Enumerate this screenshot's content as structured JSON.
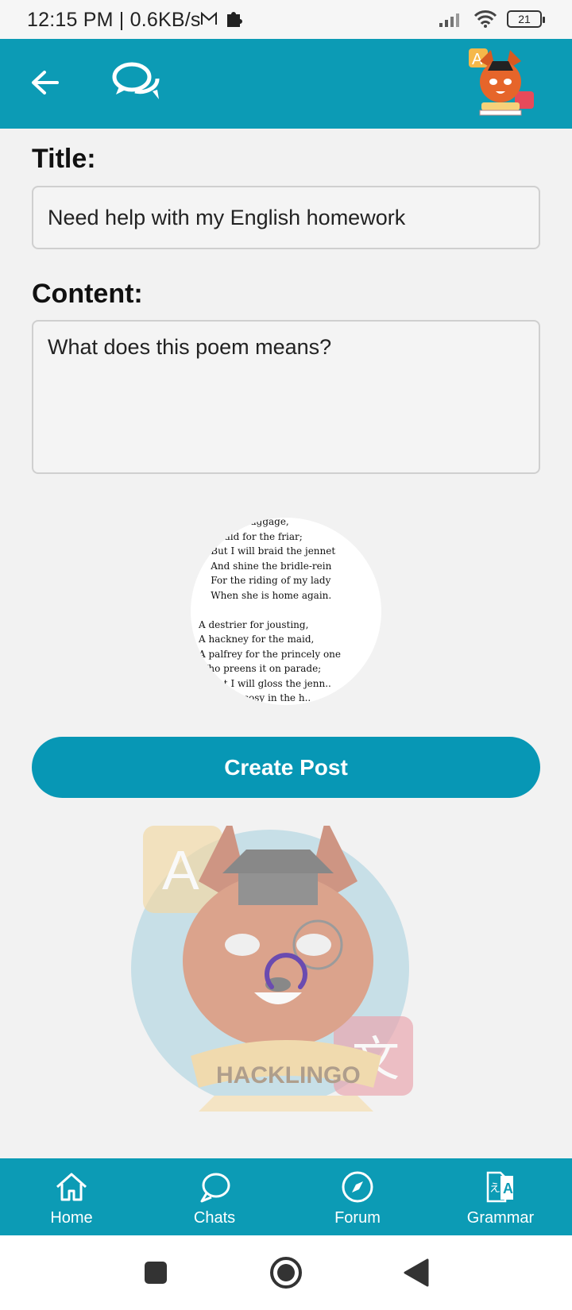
{
  "status_bar": {
    "time_speed": "12:15 PM | 0.6KB/s",
    "battery": "21",
    "icons": [
      "mail-icon",
      "puzzle-icon",
      "signal-icon",
      "wifi-icon",
      "battery-icon"
    ]
  },
  "app_bar": {
    "icons": [
      "back-arrow-icon",
      "chat-bubbles-icon",
      "hacklingo-logo"
    ]
  },
  "form": {
    "title_label": "Title:",
    "title_value": "Need help with my English homework",
    "content_label": "Content:",
    "content_value": "What does this poem means?"
  },
  "preview": {
    "poem_lines": [
      "   . ... the baggage,",
      "..ewbald for the friar;",
      "    But I will braid the jennet",
      "    And shine the bridle-rein",
      "    For the riding of my lady",
      "    When she is home again.",
      "",
      "A destrier for jousting,",
      "A hackney for the maid,",
      "A palfrey for the princely one",
      "Who preens it on parade;",
      "    But I will gloss the jenn..",
      "    ...at is cosy in the h.."
    ]
  },
  "actions": {
    "create_post": "Create Post"
  },
  "mascot": {
    "banner": "HACKLINGO"
  },
  "bottom_nav": {
    "items": [
      {
        "label": "Home",
        "icon": "home-icon"
      },
      {
        "label": "Chats",
        "icon": "chat-icon"
      },
      {
        "label": "Forum",
        "icon": "compass-icon"
      },
      {
        "label": "Grammar",
        "icon": "translate-icon"
      }
    ]
  },
  "colors": {
    "primary": "#0c9bb5",
    "button": "#0797b5",
    "spinner": "#6a4bb0"
  }
}
